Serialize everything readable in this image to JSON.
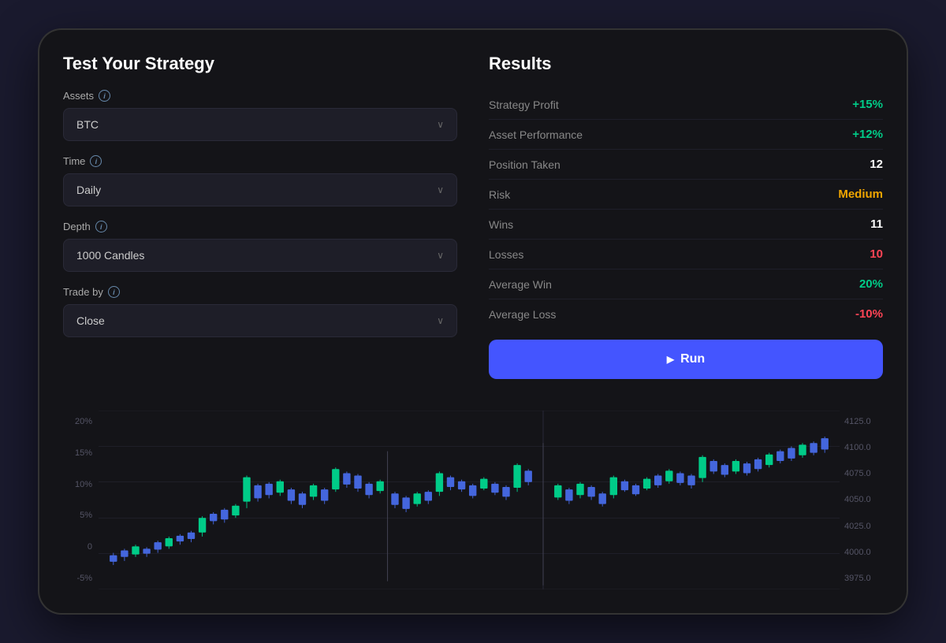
{
  "left": {
    "title": "Test Your Strategy",
    "fields": [
      {
        "label": "Assets",
        "value": "BTC",
        "hasInfo": true
      },
      {
        "label": "Time",
        "value": "Daily",
        "hasInfo": true
      },
      {
        "label": "Depth",
        "value": "1000 Candles",
        "hasInfo": true
      },
      {
        "label": "Trade by",
        "value": "Close",
        "hasInfo": true
      }
    ]
  },
  "right": {
    "title": "Results",
    "rows": [
      {
        "label": "Strategy Profit",
        "value": "+15%",
        "color": "green"
      },
      {
        "label": "Asset Performance",
        "value": "+12%",
        "color": "green"
      },
      {
        "label": "Position Taken",
        "value": "12",
        "color": "white"
      },
      {
        "label": "Risk",
        "value": "Medium",
        "color": "yellow"
      },
      {
        "label": "Wins",
        "value": "11",
        "color": "white"
      },
      {
        "label": "Losses",
        "value": "10",
        "color": "red"
      },
      {
        "label": "Average Win",
        "value": "20%",
        "color": "green"
      },
      {
        "label": "Average Loss",
        "value": "-10%",
        "color": "red"
      }
    ],
    "button": "▶ Run"
  },
  "chart": {
    "yLabels": [
      "20%",
      "15%",
      "10%",
      "5%",
      "0",
      "-5%"
    ],
    "yLabelsRight": [
      "4125.0",
      "4100.0",
      "4075.0",
      "4050.0",
      "4025.0",
      "4000.0",
      "3975.0"
    ]
  }
}
